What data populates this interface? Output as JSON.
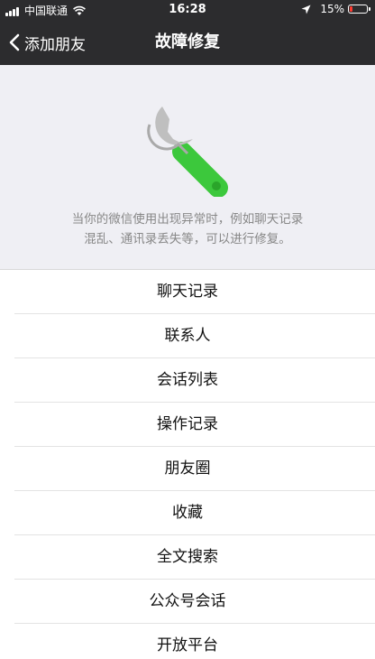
{
  "status_bar": {
    "carrier": "中国联通",
    "time": "16:28",
    "battery_percent": "15%",
    "battery_level": 0.15,
    "icons": [
      "signal-icon",
      "wifi-icon",
      "location-icon",
      "battery-icon"
    ]
  },
  "nav": {
    "back_label": "添加朋友",
    "title": "故障修复",
    "back_icon": "chevron-left-icon"
  },
  "header": {
    "icon": "wrench-icon",
    "description_line1": "当你的微信使用出现异常时，例如聊天记录",
    "description_line2": "混乱、通讯录丢失等，可以进行修复。"
  },
  "list": {
    "items": [
      {
        "label": "聊天记录"
      },
      {
        "label": "联系人"
      },
      {
        "label": "会话列表"
      },
      {
        "label": "操作记录"
      },
      {
        "label": "朋友圈"
      },
      {
        "label": "收藏"
      },
      {
        "label": "全文搜索"
      },
      {
        "label": "公众号会话"
      },
      {
        "label": "开放平台"
      }
    ]
  },
  "colors": {
    "bar_background": "#2c2c2e",
    "page_background": "#efeff4",
    "accent_green": "#3cc83c",
    "battery_low": "#ff3b30"
  }
}
